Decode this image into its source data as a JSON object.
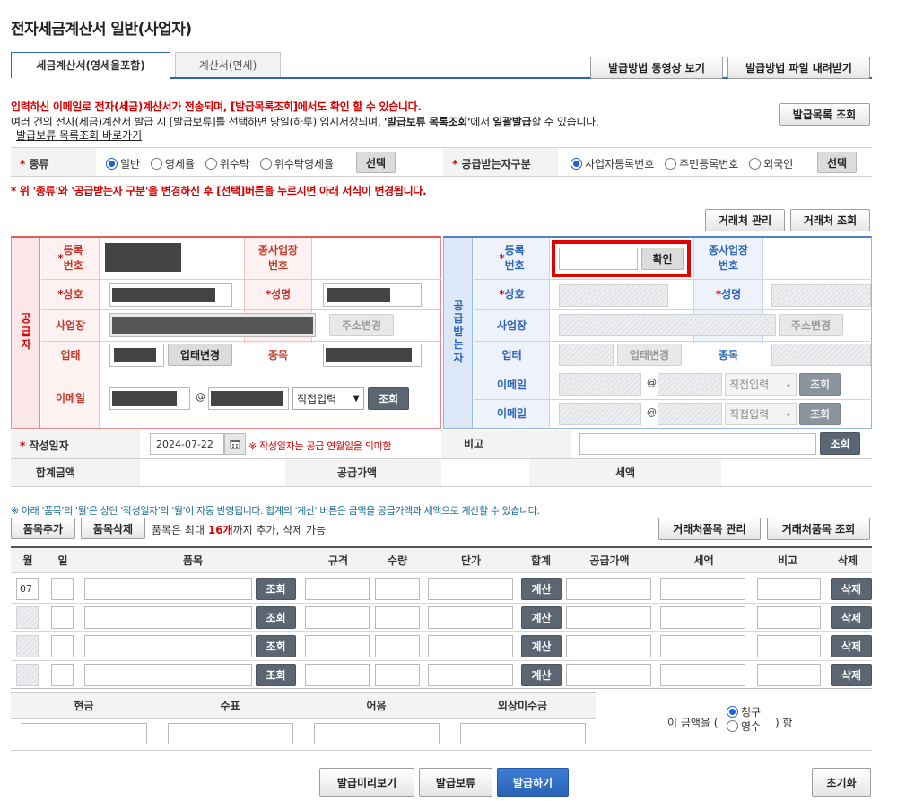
{
  "page_title": "전자세금계산서 일반(사업자)",
  "tabs": [
    {
      "label": "세금계산서(영세율포함)"
    },
    {
      "label": "계산서(면세)"
    }
  ],
  "top_buttons": {
    "video": "발급방법 동영상 보기",
    "download": "발급방법 파일 내려받기",
    "list": "발급목록 조회"
  },
  "notice": {
    "line1": "입력하신 이메일로 전자(세금)계산서가 전송되며, [발급목록조회]에서도 확인 할 수 있습니다.",
    "line2_a": "여러 건의 전자(세금)계산서 발급 시 [발급보류]를 선택하면 당일(하루) 임시저장되며, ",
    "line2_b": "'발급보류 목록조회'",
    "line2_c": "에서 ",
    "line2_d": "일괄발급",
    "line2_e": "할 수 있습니다.",
    "link": "발급보류 목록조회 바로가기"
  },
  "kind": {
    "label": "종류",
    "options": [
      "일반",
      "영세율",
      "위수탁",
      "위수탁영세율"
    ],
    "selected": 0,
    "button": "선택"
  },
  "receiver_kind": {
    "label": "공급받는자구분",
    "options": [
      "사업자등록번호",
      "주민등록번호",
      "외국인"
    ],
    "selected": 0,
    "button": "선택"
  },
  "change_notice": "* 위 '종류'와 '공급받는자 구분'을 변경하신 후 [선택]버튼을 누르시면 아래 서식이 변경됩니다.",
  "partner_buttons": {
    "manage": "거래처 관리",
    "search": "거래처 조회"
  },
  "supplier": {
    "side_label": "공급자",
    "reg_no": "등록\n번호",
    "sub_biz": "종사업장\n번호",
    "company": "상호",
    "name": "성명",
    "address": "사업장",
    "address_button": "주소변경",
    "biz_type": "업태",
    "biz_type_button": "업태변경",
    "item": "종목",
    "email": "이메일",
    "at": "@",
    "domain_select": "직접입력",
    "search_button": "조회"
  },
  "receiver": {
    "side_label": "공급받는자",
    "reg_no": "등록\n번호",
    "confirm_button": "확인",
    "sub_biz": "종사업장\n번호",
    "company": "상호",
    "name": "성명",
    "address": "사업장",
    "address_button": "주소변경",
    "biz_type": "업태",
    "biz_type_button": "업태변경",
    "item": "종목",
    "email1": "이메일",
    "email2": "이메일",
    "at": "@",
    "domain_select": "직접입력",
    "search_button": "조회"
  },
  "write_date": {
    "label": "작성일자",
    "value": "2024-07-22",
    "note": "※ 작성일자는 공급 연월일을 의미함"
  },
  "memo": {
    "label": "비고",
    "button": "조회"
  },
  "totals": {
    "total": "합계금액",
    "supply": "공급가액",
    "tax": "세액"
  },
  "items_notice": "※ 아래 '품목'의 '월'은 상단 '작성일자'의 '월'이 자동 반영됩니다. 합계의 '계산' 버튼은 금액을 공급가액과 세액으로 계산할 수 있습니다.",
  "item_controls": {
    "add": "품목추가",
    "delete": "품목삭제",
    "limit_a": "품목은 최대 ",
    "limit_b": "16개",
    "limit_c": "까지 추가, 삭제 가능",
    "partner_items": "거래처품목 관리",
    "partner_items_search": "거래처품목 조회"
  },
  "item_headers": [
    "월",
    "일",
    "품목",
    "규격",
    "수량",
    "단가",
    "합계",
    "공급가액",
    "세액",
    "비고",
    "삭제"
  ],
  "item_rows": [
    {
      "month": "07"
    },
    {
      "month": ""
    },
    {
      "month": ""
    },
    {
      "month": ""
    }
  ],
  "row_buttons": {
    "search": "조회",
    "calc": "계산",
    "delete": "삭제"
  },
  "payment": {
    "headers": [
      "현금",
      "수표",
      "어음",
      "외상미수금"
    ],
    "prefix": "이 금액을 (",
    "options": [
      "청구",
      "영수"
    ],
    "selected": 0,
    "suffix": ") 함"
  },
  "bottom_buttons": {
    "preview": "발급미리보기",
    "hold": "발급보류",
    "issue": "발급하기",
    "reset": "초기화"
  }
}
